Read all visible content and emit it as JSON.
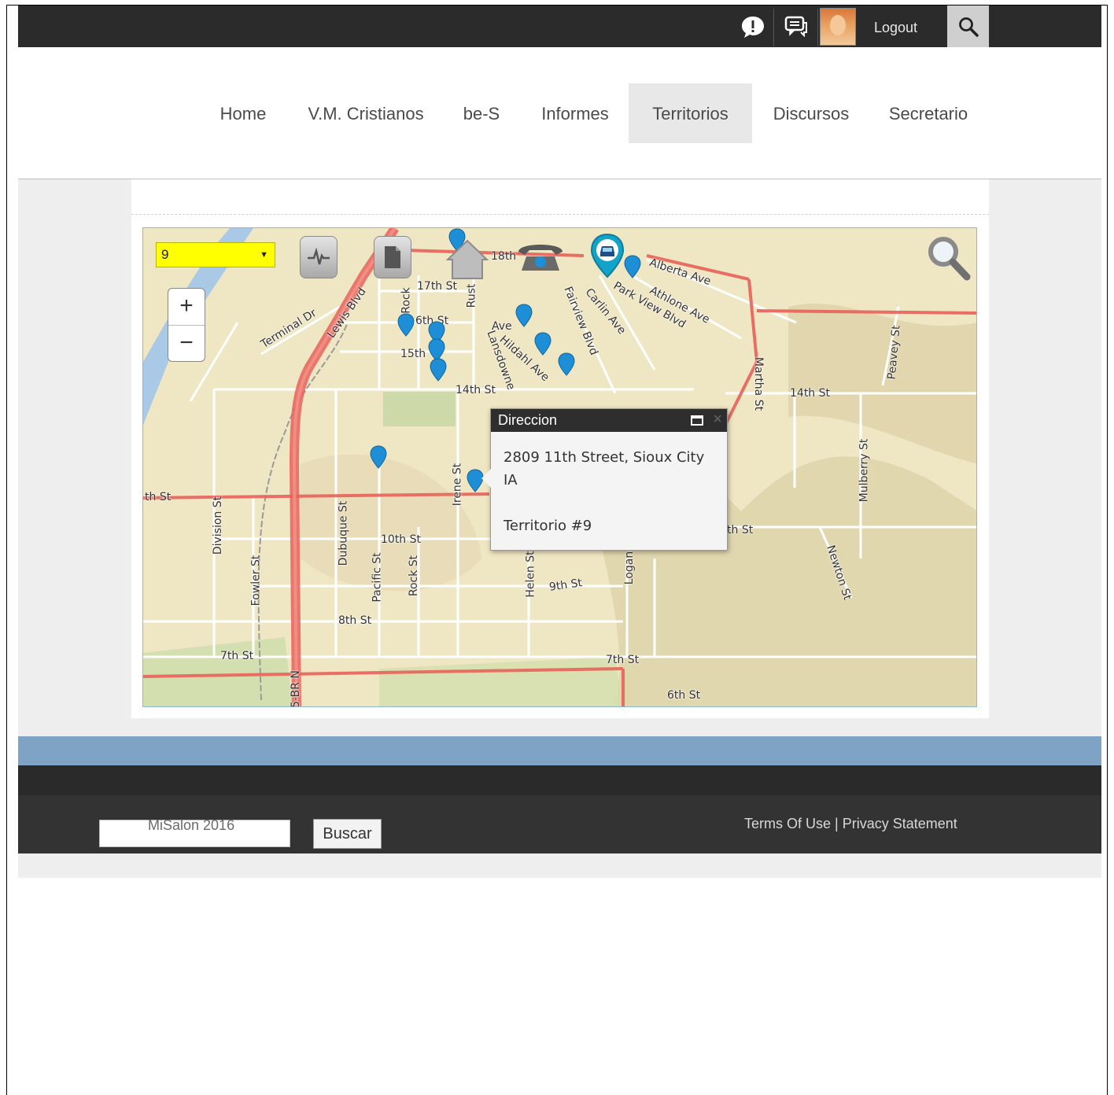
{
  "topbar": {
    "notification_icon": "alert-bubble-icon",
    "messages_icon": "chat-bubbles-icon",
    "logout_label": "Logout",
    "search_icon": "search-icon"
  },
  "nav": {
    "items": [
      {
        "label": "Home",
        "active": false
      },
      {
        "label": "V.M. Cristianos",
        "active": false
      },
      {
        "label": "be-S",
        "active": false
      },
      {
        "label": "Informes",
        "active": false
      },
      {
        "label": "Territorios",
        "active": true
      },
      {
        "label": "Discursos",
        "active": false
      },
      {
        "label": "Secretario",
        "active": false
      }
    ]
  },
  "map": {
    "territory_select": "9",
    "streets": [
      "18th",
      "17th St",
      "Rock",
      "Rust",
      "6th St",
      "15th",
      "14th St",
      "Ave",
      "Hildahl Ave",
      "Lansdowne",
      "Fairview Blvd",
      "Carlin Ave",
      "Park View Blvd",
      "Athlone Ave",
      "Alberta Ave",
      "Martha St",
      "14th St",
      "Peavey St",
      "Mulberry St",
      "Terminal Dr",
      "Lewis Blvd",
      "th St",
      "Division St",
      "Dubuque St",
      "10th St",
      "Pacific St",
      "Rock St",
      "Irene St",
      "Fowler St",
      "8th St",
      "Helen St",
      "9th St",
      "Logan",
      "th St",
      "Newton St",
      "7th St",
      "7th St",
      "6th St",
      "5-BR N"
    ],
    "zoom_in": "+",
    "zoom_out": "−",
    "popup": {
      "title": "Direccion",
      "address_line1": "2809 11th Street, Sioux City",
      "address_line2": "IA",
      "territory": "Territorio #9"
    }
  },
  "footer": {
    "copyright": "MiSalon 2016",
    "search_placeholder": "",
    "search_button": "Buscar",
    "terms": "Terms Of Use",
    "separator": "|",
    "privacy": "Privacy Statement"
  },
  "colors": {
    "topbar": "#2b2b2b",
    "select_highlight": "#ffff00",
    "pin": "#1e8fd6",
    "road": "#e8625a",
    "band_blue": "#7fa3c4"
  }
}
